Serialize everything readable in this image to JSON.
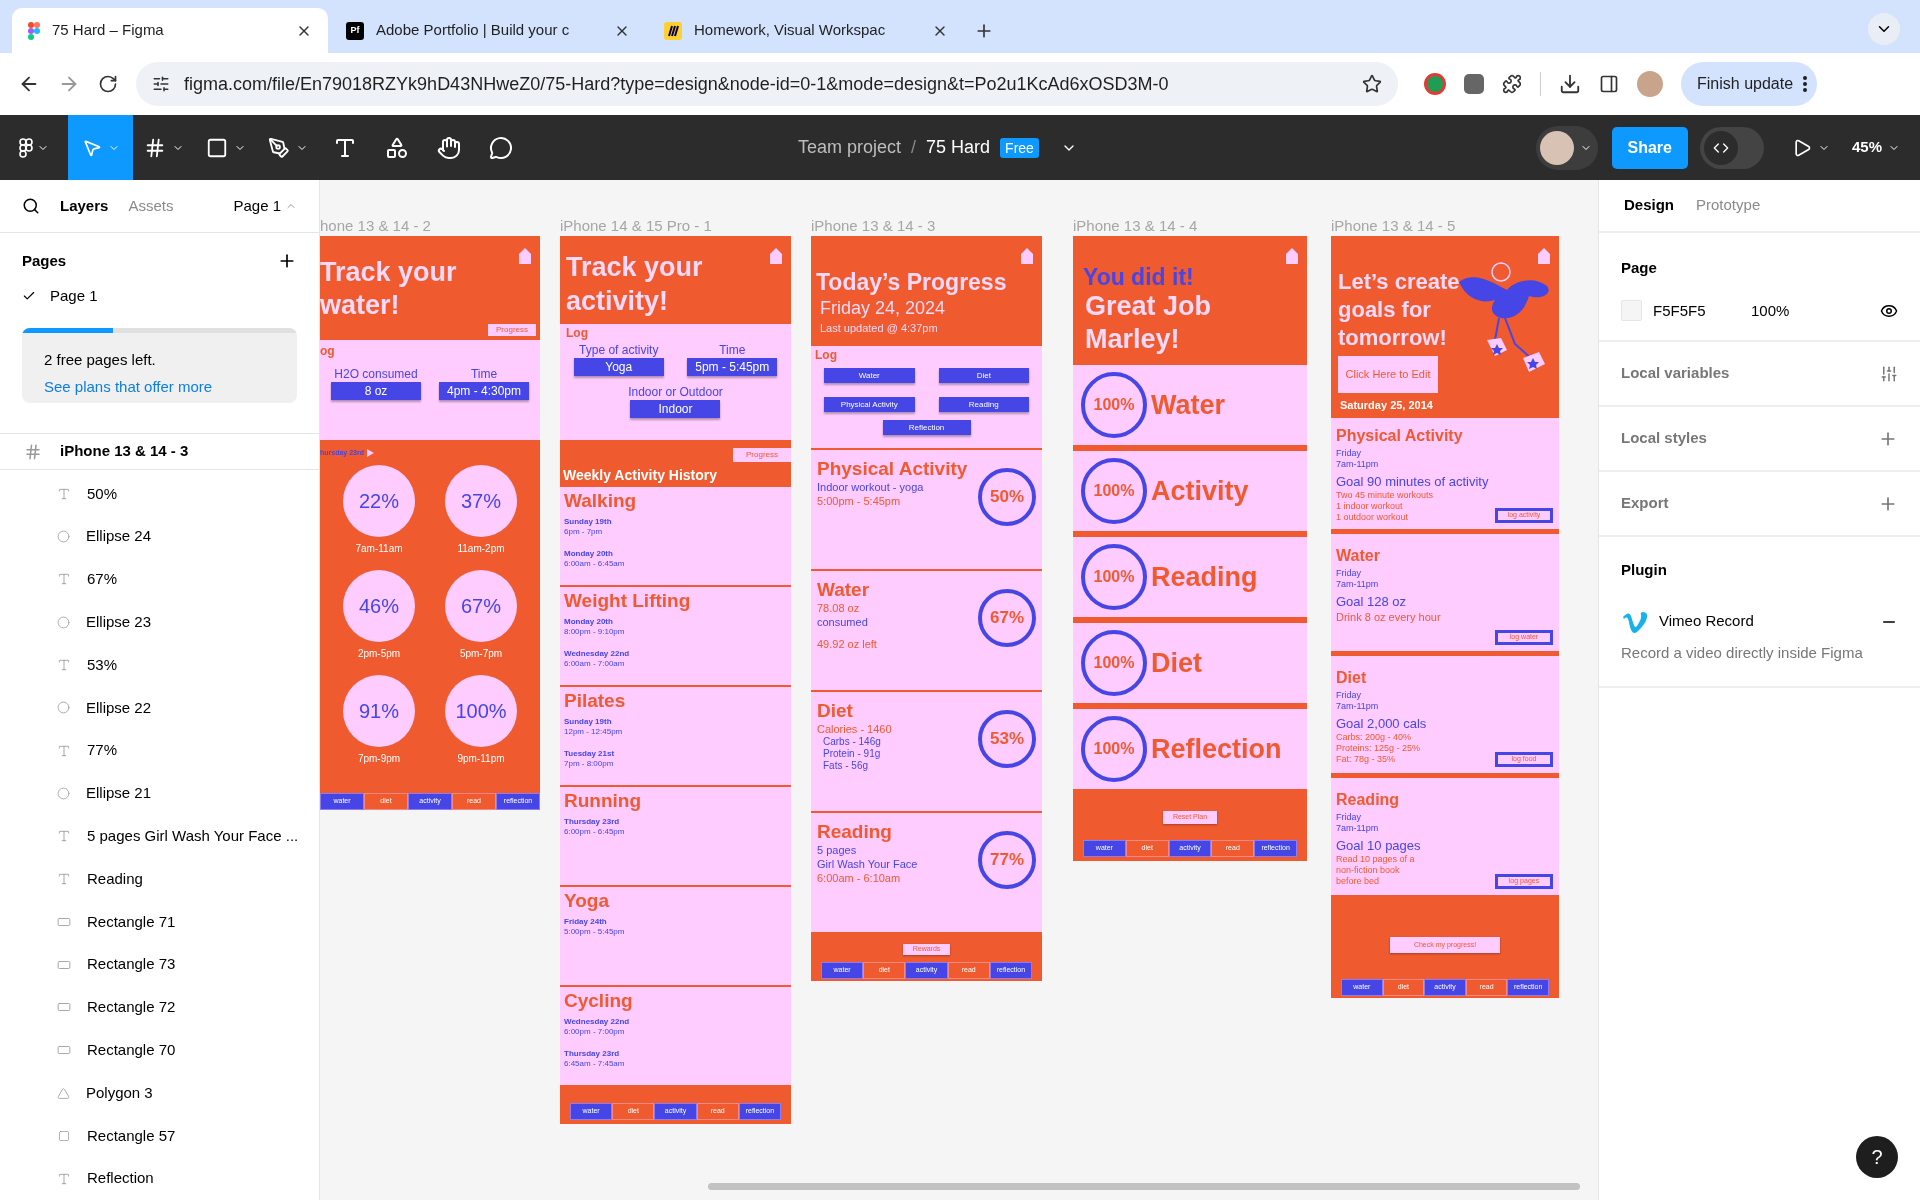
{
  "browser": {
    "tabs": [
      {
        "title": "75 Hard – Figma",
        "selected": true
      },
      {
        "title": "Adobe Portfolio | Build your c",
        "badge": "Pf",
        "selected": false
      },
      {
        "title": "Homework, Visual Workspac",
        "selected": false
      }
    ],
    "url": "figma.com/file/En79018RZYk9hD43NHweZ0/75-Hard?type=design&node-id=0-1&mode=design&t=Po2u1KcAd6xOSD3M-0",
    "update_button": "Finish update"
  },
  "toolbar": {
    "project": "Team project",
    "separator": "/",
    "file": "75 Hard",
    "dev_mode": false,
    "plan_badge": "Free",
    "share": "Share",
    "zoom": "45%"
  },
  "left_panel": {
    "tabs": [
      {
        "label": "Layers",
        "selected": true
      },
      {
        "label": "Assets",
        "selected": false
      }
    ],
    "page_menu": "Page 1",
    "pages_title": "Pages",
    "pages": [
      {
        "label": "Page 1",
        "selected": true
      }
    ],
    "notice": {
      "level": 0.33,
      "text": "2 free pages left.",
      "link": "See plans that offer more"
    },
    "frame": "iPhone 13 & 14 - 3",
    "layers": [
      {
        "kind": "text",
        "name": "50%"
      },
      {
        "kind": "ellipse",
        "name": "Ellipse 24"
      },
      {
        "kind": "text",
        "name": "67%"
      },
      {
        "kind": "ellipse",
        "name": "Ellipse 23"
      },
      {
        "kind": "text",
        "name": "53%"
      },
      {
        "kind": "ellipse",
        "name": "Ellipse 22"
      },
      {
        "kind": "text",
        "name": "77%"
      },
      {
        "kind": "ellipse",
        "name": "Ellipse 21"
      },
      {
        "kind": "text",
        "name": "5 pages Girl Wash Your Face ..."
      },
      {
        "kind": "text",
        "name": "Reading"
      },
      {
        "kind": "rectangle",
        "name": "Rectangle 71"
      },
      {
        "kind": "rectangle",
        "name": "Rectangle 73"
      },
      {
        "kind": "rectangle",
        "name": "Rectangle 72"
      },
      {
        "kind": "rectangle",
        "name": "Rectangle 70"
      },
      {
        "kind": "polygon",
        "name": "Polygon 3"
      },
      {
        "kind": "frame_rect",
        "name": "Rectangle 57"
      },
      {
        "kind": "text",
        "name": "Reflection"
      }
    ]
  },
  "right_panel": {
    "tabs": [
      {
        "label": "Design",
        "selected": true
      },
      {
        "label": "Prototype",
        "selected": false
      }
    ],
    "page_title": "Page",
    "page_color": "F5F5F5",
    "page_opacity": "100%",
    "sections": [
      {
        "title": "Local variables",
        "kind": "variables"
      },
      {
        "title": "Local styles",
        "kind": "add"
      },
      {
        "title": "Export",
        "kind": "add"
      }
    ],
    "plugin_title": "Plugin",
    "plugin": {
      "name": "Vimeo Record",
      "description": "Record a video directly inside Figma"
    }
  },
  "canvas": {
    "frames": [
      {
        "kind": "water",
        "label": "hone 13 & 14 - 2",
        "title": "Track your water!",
        "progress_button": "Progress",
        "log_title": "og",
        "fields": [
          {
            "label": "H2O consumed",
            "value": "8 oz"
          },
          {
            "label": "Time",
            "value": "4pm - 4:30pm"
          }
        ],
        "day": "hursday 23rd",
        "circles": [
          {
            "percent": "22%",
            "time": "7am-11am"
          },
          {
            "percent": "37%",
            "time": "11am-2pm"
          },
          {
            "percent": "46%",
            "time": "2pm-5pm"
          },
          {
            "percent": "67%",
            "time": "5pm-7pm"
          },
          {
            "percent": "91%",
            "time": "7pm-9pm"
          },
          {
            "percent": "100%",
            "time": "9pm-11pm"
          }
        ],
        "nav": [
          "water",
          "diet",
          "activity",
          "read",
          "reflection"
        ]
      },
      {
        "kind": "activity",
        "label": "iPhone 14 & 15 Pro - 1",
        "title": "Track your activity!",
        "log_title": "Log",
        "fields": [
          {
            "label": "Type of activity",
            "value": "Yoga"
          },
          {
            "label": "Time",
            "value": "5pm - 5:45pm"
          },
          {
            "label": "Indoor or Outdoor",
            "value": "Indoor"
          }
        ],
        "progress_button": "Progress",
        "history_title": "Weekly Activity History",
        "activities": [
          {
            "name": "Walking",
            "sessions": [
              {
                "day": "Sunday 19th",
                "time": "6pm - 7pm"
              },
              {
                "day": "Monday 20th",
                "time": "6:00am - 6:45am"
              }
            ]
          },
          {
            "name": "Weight Lifting",
            "sessions": [
              {
                "day": "Monday 20th",
                "time": "8:00pm - 9:10pm"
              },
              {
                "day": "Wednesday 22nd",
                "time": "6:00am - 7:00am"
              }
            ]
          },
          {
            "name": "Pilates",
            "sessions": [
              {
                "day": "Sunday 19th",
                "time": "12pm - 12:45pm"
              },
              {
                "day": "Tuesday 21st",
                "time": "7pm - 8:00pm"
              }
            ]
          },
          {
            "name": "Running",
            "sessions": [
              {
                "day": "Thursday 23rd",
                "time": "6:00pm - 6:45pm"
              }
            ]
          },
          {
            "name": "Yoga",
            "sessions": [
              {
                "day": "Friday 24th",
                "time": "5:00pm - 5:45pm"
              }
            ]
          },
          {
            "name": "Cycling",
            "sessions": [
              {
                "day": "Wednesday 22nd",
                "time": "6:00pm - 7:00pm"
              },
              {
                "day": "Thursday 23rd",
                "time": "6:45am - 7:45am"
              }
            ]
          }
        ],
        "nav": [
          "water",
          "diet",
          "activity",
          "read",
          "reflection"
        ]
      },
      {
        "kind": "progress",
        "label": "iPhone 13 & 14 - 3",
        "title": "Today’s Progress",
        "date": "Friday 24, 2024",
        "updated": "Last updated @ 4:37pm",
        "log_title": "Log",
        "log_buttons": [
          "Water",
          "Diet",
          "Physical Activity",
          "Reading",
          "Reflection"
        ],
        "cards": [
          {
            "title": "Physical Activity",
            "percent": "50%",
            "lines": [
              {
                "text": "Indoor workout - yoga",
                "color": "#4646e6",
                "kind": "main"
              },
              {
                "text": "5:00pm - 5:45pm",
                "color": "#ef5a2f",
                "kind": "main"
              }
            ]
          },
          {
            "title": "Water",
            "percent": "67%",
            "lines": [
              {
                "text": "78.08 oz",
                "color": "#ef5a2f",
                "kind": "main"
              },
              {
                "text": "consumed",
                "color": "#4646e6",
                "kind": "main"
              },
              {
                "text": "49.92 oz left",
                "color": "#ef5a2f",
                "kind": "gap"
              }
            ]
          },
          {
            "title": "Diet",
            "percent": "53%",
            "lines": [
              {
                "text": "Calories - 1460",
                "color": "#ef5a2f",
                "kind": "main"
              },
              {
                "text": "Carbs - 146g",
                "color": "#4646e6",
                "kind": "detail"
              },
              {
                "text": "Protein - 91g",
                "color": "#4646e6",
                "kind": "detail"
              },
              {
                "text": "Fats - 56g",
                "color": "#4646e6",
                "kind": "detail"
              }
            ]
          },
          {
            "title": "Reading",
            "percent": "77%",
            "lines": [
              {
                "text": "5 pages",
                "color": "#4646e6",
                "kind": "main"
              },
              {
                "text": "Girl Wash Your Face",
                "color": "#4646e6",
                "kind": "main"
              },
              {
                "text": "6:00am - 6:10am",
                "color": "#ef5a2f",
                "kind": "main"
              }
            ]
          }
        ],
        "footer_button": "Rewards",
        "nav": [
          "water",
          "diet",
          "activity",
          "read",
          "reflection"
        ]
      },
      {
        "kind": "done",
        "label": "iPhone 13 & 14 - 4",
        "headline": "You did it!",
        "title": "Great Job Marley!",
        "items": [
          {
            "percent": "100%",
            "label": "Water"
          },
          {
            "percent": "100%",
            "label": "Activity"
          },
          {
            "percent": "100%",
            "label": "Reading"
          },
          {
            "percent": "100%",
            "label": "Diet"
          },
          {
            "percent": "100%",
            "label": "Reflection"
          }
        ],
        "footer_button": "Reset Plan",
        "nav": [
          "water",
          "diet",
          "activity",
          "read",
          "reflection"
        ]
      },
      {
        "kind": "goals",
        "label": "iPhone 13 & 14 - 5",
        "title": "Let’s create goals for tomorrow!",
        "edit_button": "Click Here to Edit",
        "date": "Saturday 25, 2014",
        "cards": [
          {
            "title": "Physical Activity",
            "day": "Friday",
            "hours": "7am-11pm",
            "goal": "Goal 90 minutes of activity",
            "notes": [
              "Two 45 minute workouts",
              "1 indoor workout",
              "1 outdoor workout"
            ],
            "button": "log activity"
          },
          {
            "title": "Water",
            "day": "Friday",
            "hours": "7am-11pm",
            "goal": "Goal 128 oz",
            "notes": [
              "Drink 8 oz every hour"
            ],
            "button": "log water"
          },
          {
            "title": "Diet",
            "day": "Friday",
            "hours": "7am-11pm",
            "goal": "Goal 2,000 cals",
            "notes": [
              "Carbs: 200g - 40%",
              "Proteins: 125g - 25%",
              "Fat: 78g - 35%"
            ],
            "button": "log food"
          },
          {
            "title": "Reading",
            "day": "Friday",
            "hours": "7am-11pm",
            "goal": "Goal 10 pages",
            "notes": [
              "Read 10 pages of a",
              "non-fiction book",
              "before bed"
            ],
            "button": "log pages"
          }
        ],
        "footer_button": "Check my progress!",
        "nav": [
          "water",
          "diet",
          "activity",
          "read",
          "reflection"
        ]
      }
    ]
  },
  "help": "?"
}
